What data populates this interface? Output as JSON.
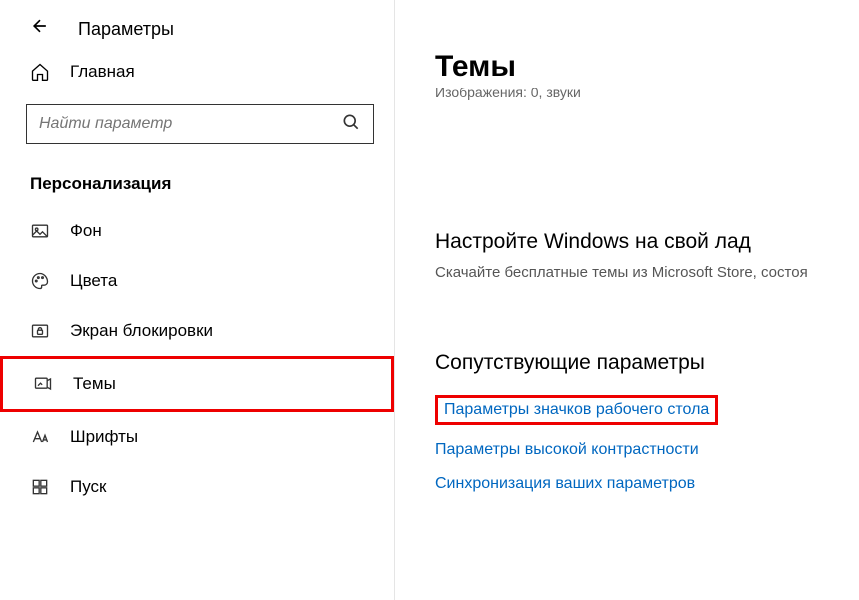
{
  "window": {
    "title": "Параметры"
  },
  "sidebar": {
    "home_label": "Главная",
    "search_placeholder": "Найти параметр",
    "section_title": "Персонализация",
    "items": [
      {
        "label": "Фон"
      },
      {
        "label": "Цвета"
      },
      {
        "label": "Экран блокировки"
      },
      {
        "label": "Темы"
      },
      {
        "label": "Шрифты"
      },
      {
        "label": "Пуск"
      }
    ]
  },
  "main": {
    "title": "Темы",
    "subtext_cut": "Изображения: 0, звуки",
    "customize_heading": "Настройте Windows на свой лад",
    "customize_desc": "Скачайте бесплатные темы из Microsoft Store, состоя",
    "related_heading": "Сопутствующие параметры",
    "links": [
      "Параметры значков рабочего стола",
      "Параметры высокой контрастности",
      "Синхронизация ваших параметров"
    ]
  }
}
